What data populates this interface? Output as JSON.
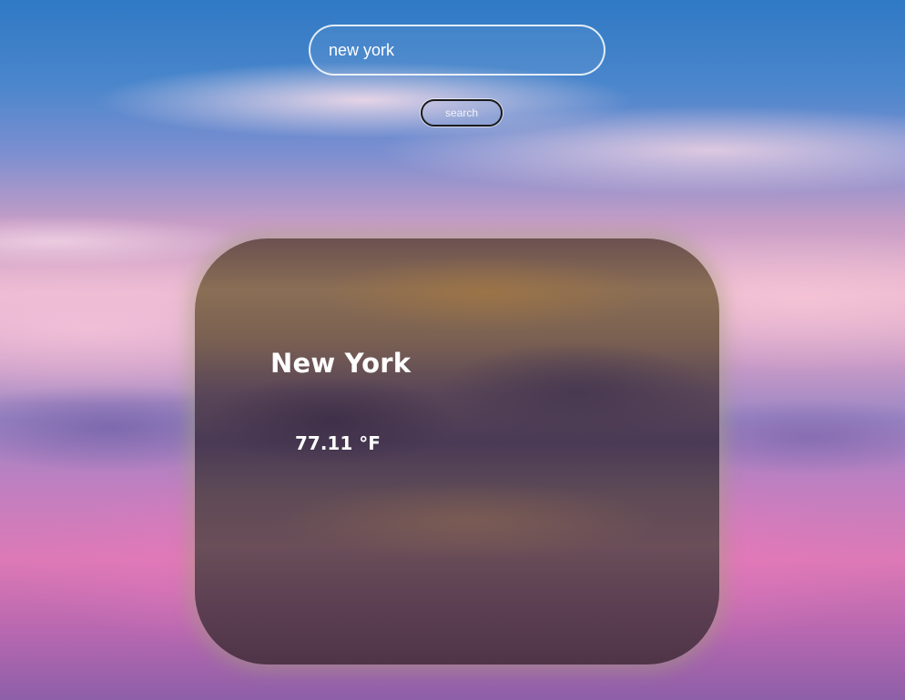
{
  "search": {
    "value": "new york",
    "button_label": "search"
  },
  "weather": {
    "city": "New York",
    "temperature": "77.11 °F"
  }
}
